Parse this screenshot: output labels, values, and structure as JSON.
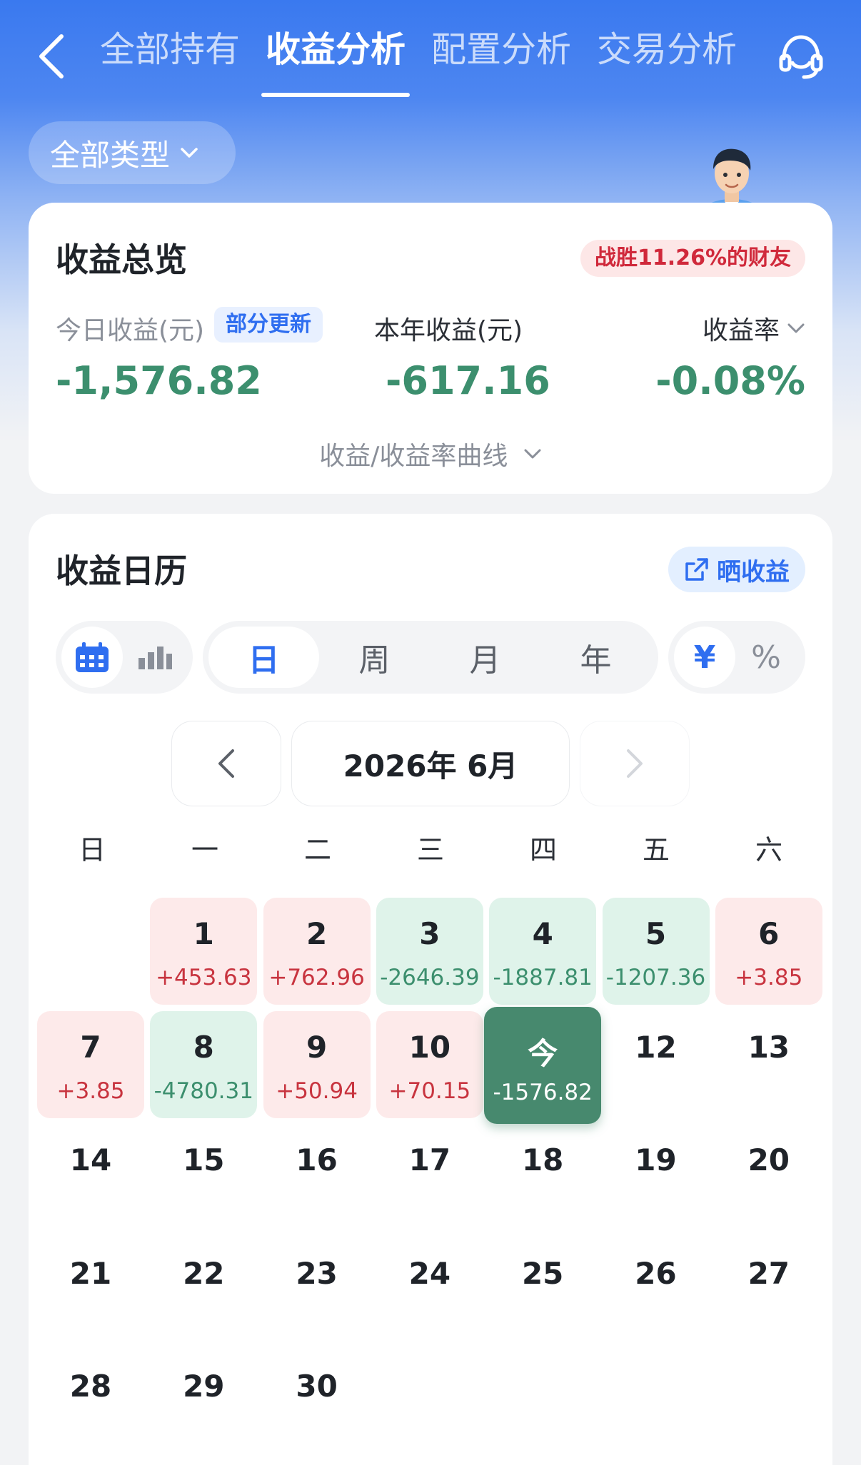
{
  "nav": {
    "tabs": [
      "全部持有",
      "收益分析",
      "配置分析",
      "交易分析"
    ],
    "active_tab": "收益分析"
  },
  "filter": {
    "label": "全部类型"
  },
  "overview": {
    "title": "收益总览",
    "rank_badge": "战胜11.26%的财友",
    "today_label": "今日收益(元)",
    "update_badge": "部分更新",
    "today_value": "-1,576.82",
    "year_label": "本年收益(元)",
    "year_value": "-617.16",
    "rate_label": "收益率",
    "rate_value": "-0.08%",
    "curve_toggle": "收益/收益率曲线"
  },
  "calendar": {
    "title": "收益日历",
    "share_label": "晒收益",
    "periods": [
      "日",
      "周",
      "月",
      "年"
    ],
    "active_period": "日",
    "unit_options": [
      "¥",
      "%"
    ],
    "month_label": "2026年 6月",
    "weekdays": [
      "日",
      "一",
      "二",
      "三",
      "四",
      "五",
      "六"
    ],
    "days": [
      {
        "day": "1",
        "pnl": "+453.63",
        "type": "pos"
      },
      {
        "day": "2",
        "pnl": "+762.96",
        "type": "pos"
      },
      {
        "day": "3",
        "pnl": "-2646.39",
        "type": "neg"
      },
      {
        "day": "4",
        "pnl": "-1887.81",
        "type": "neg"
      },
      {
        "day": "5",
        "pnl": "-1207.36",
        "type": "neg"
      },
      {
        "day": "6",
        "pnl": "+3.85",
        "type": "pos"
      },
      {
        "day": "7",
        "pnl": "+3.85",
        "type": "pos"
      },
      {
        "day": "8",
        "pnl": "-4780.31",
        "type": "neg"
      },
      {
        "day": "9",
        "pnl": "+50.94",
        "type": "pos"
      },
      {
        "day": "10",
        "pnl": "+70.15",
        "type": "pos"
      },
      {
        "day": "今",
        "pnl": "-1576.82",
        "type": "today"
      },
      {
        "day": "12",
        "pnl": "",
        "type": "none"
      },
      {
        "day": "13",
        "pnl": "",
        "type": "none"
      },
      {
        "day": "14",
        "pnl": "",
        "type": "none"
      },
      {
        "day": "15",
        "pnl": "",
        "type": "none"
      },
      {
        "day": "16",
        "pnl": "",
        "type": "none"
      },
      {
        "day": "17",
        "pnl": "",
        "type": "none"
      },
      {
        "day": "18",
        "pnl": "",
        "type": "none"
      },
      {
        "day": "19",
        "pnl": "",
        "type": "none"
      },
      {
        "day": "20",
        "pnl": "",
        "type": "none"
      },
      {
        "day": "21",
        "pnl": "",
        "type": "none"
      },
      {
        "day": "22",
        "pnl": "",
        "type": "none"
      },
      {
        "day": "23",
        "pnl": "",
        "type": "none"
      },
      {
        "day": "24",
        "pnl": "",
        "type": "none"
      },
      {
        "day": "25",
        "pnl": "",
        "type": "none"
      },
      {
        "day": "26",
        "pnl": "",
        "type": "none"
      },
      {
        "day": "27",
        "pnl": "",
        "type": "none"
      },
      {
        "day": "28",
        "pnl": "",
        "type": "none"
      },
      {
        "day": "29",
        "pnl": "",
        "type": "none"
      },
      {
        "day": "30",
        "pnl": "",
        "type": "none"
      }
    ]
  },
  "icons": [
    "back-arrow-icon",
    "customer-service-icon",
    "chevron-down-icon",
    "share-icon",
    "calendar-icon",
    "bar-chart-icon",
    "chevron-left-icon",
    "chevron-right-icon"
  ],
  "colors": {
    "brand_blue": "#3a79ef",
    "gain_red": "#c8343f",
    "loss_green": "#3c8f6e",
    "today_green": "#47896e"
  }
}
